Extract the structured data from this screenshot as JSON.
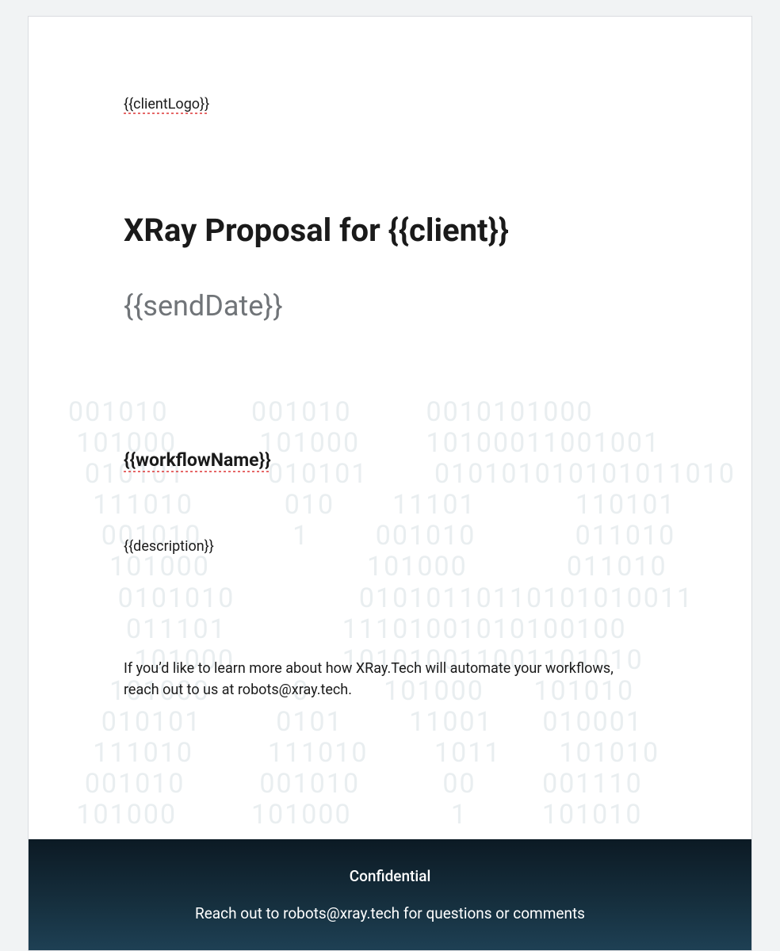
{
  "clientLogoPlaceholder": "{{clientLogo}}",
  "title": "XRay Proposal for {{client}}",
  "sendDate": "{{sendDate}}",
  "workflowName": "{{workflowName}}",
  "description": "{{description}}",
  "ctaText": "If you’d like to learn more about how XRay.Tech will automate your workflows, reach out to us at robots@xray.tech.",
  "footer": {
    "confidential": "Confidential",
    "contact": "Reach out to robots@xray.tech for questions or comments"
  },
  "binaryBackground": "001010          001010         0010101000\n 101000          101000        10100011001001\n  010101          010101        010101010101011010\n   111010           010       11101            110101\n    001010           1        001010            011010\n     101000                   101000            011010\n      0101010               01010110110101010011\n       011101              11101001010100100\n        101000             101010011001101010\n     101000          0         101000      101010\n    010101         0101        11001      010001\n   111010         111010        1011       101010\n  001010         001010          00        001110\n 101000         101000            1         101010"
}
